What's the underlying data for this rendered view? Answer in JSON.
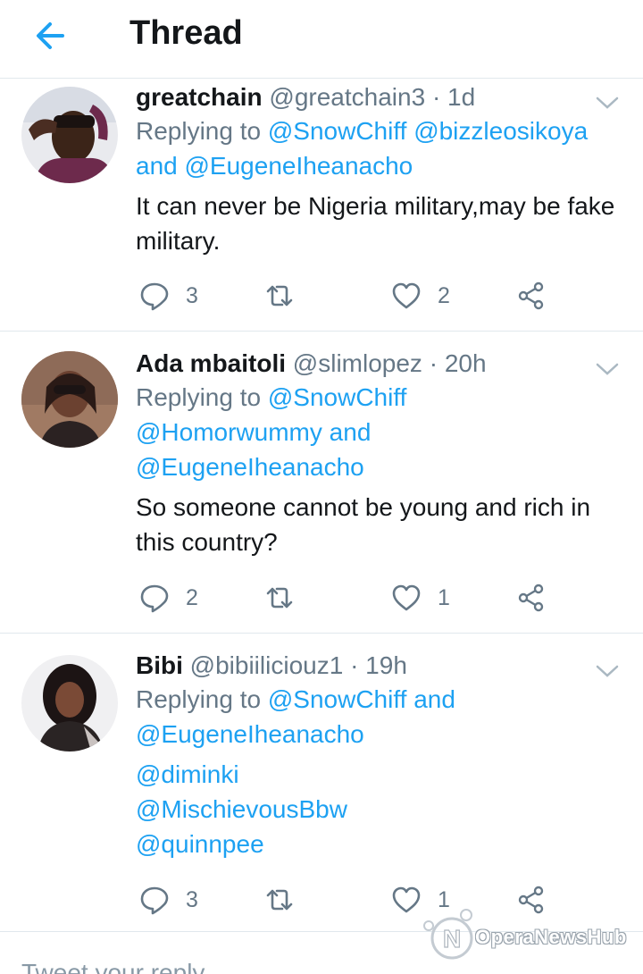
{
  "header": {
    "title": "Thread"
  },
  "tweets": [
    {
      "name": "greatchain",
      "handle": "@greatchain3",
      "time": "1d",
      "replying_prefix": "Replying to ",
      "mentions": [
        "@SnowChiff",
        "@bizzleosikoya"
      ],
      "and_text": "and",
      "last_mention": "@EugeneIheanacho",
      "text": "It can never be Nigeria military,may be fake military.",
      "replies": "3",
      "retweets": "",
      "likes": "2"
    },
    {
      "name": "Ada mbaitoli",
      "handle": "@slimlopez",
      "time": "20h",
      "replying_prefix": "Replying to ",
      "mentions": [
        "@SnowChiff",
        "@Homorwummy"
      ],
      "and_text": "and",
      "last_mention": "@EugeneIheanacho",
      "text": "So someone cannot be young and rich in this country?",
      "replies": "2",
      "retweets": "",
      "likes": "1"
    },
    {
      "name": "Bibi",
      "handle": "@bibiiliciouz1",
      "time": "19h",
      "replying_prefix": "Replying to ",
      "mentions": [
        "@SnowChiff"
      ],
      "and_text": "and",
      "last_mention": "@EugeneIheanacho",
      "extra_mentions": [
        "@diminki",
        "@MischievousBbw",
        "@quinnpee"
      ],
      "replies": "3",
      "retweets": "",
      "likes": "1"
    }
  ],
  "reply_box": {
    "placeholder": "Tweet your reply"
  },
  "watermark": {
    "text": "OperaNewsHub"
  },
  "colors": {
    "accent": "#1da1f2",
    "muted": "#657786",
    "text": "#14171a",
    "divider": "#e1e8ed"
  },
  "icons": [
    "back-arrow-icon",
    "chevron-down-icon",
    "reply-icon",
    "retweet-icon",
    "like-icon",
    "share-icon"
  ]
}
